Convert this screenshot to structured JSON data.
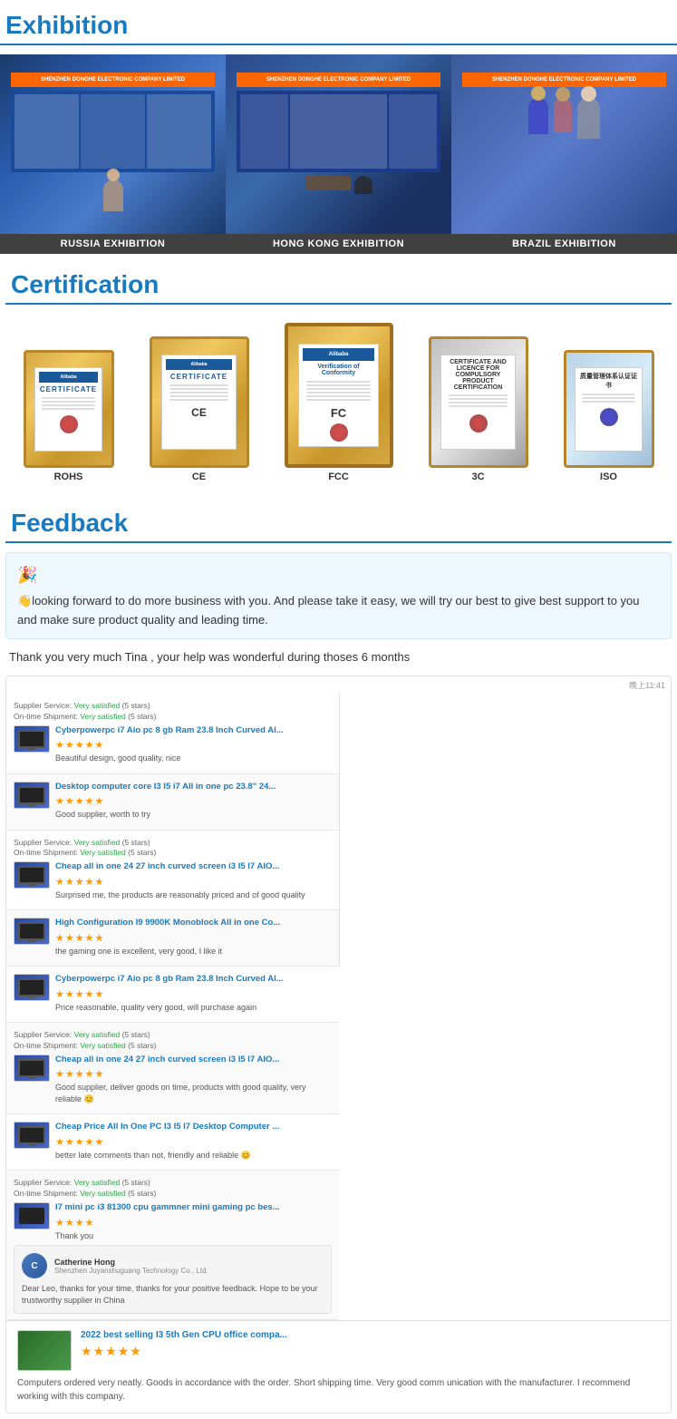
{
  "exhibition": {
    "title": "Exhibition",
    "items": [
      {
        "label": "RUSSIA EXHIBITION",
        "type": "russia"
      },
      {
        "label": "HONG KONG EXHIBITION",
        "type": "hongkong"
      },
      {
        "label": "BRAZIL EXHIBITION",
        "type": "brazil"
      }
    ],
    "company_name": "SHENZHEN DONGHE ELECTRONIC COMPANY LIMITED"
  },
  "certification": {
    "title": "Certification",
    "items": [
      {
        "label": "ROHS",
        "size": "small"
      },
      {
        "label": "CE",
        "size": "medium"
      },
      {
        "label": "FCC",
        "size": "large"
      },
      {
        "label": "3C",
        "size": "medium"
      },
      {
        "label": "ISO",
        "size": "small"
      }
    ]
  },
  "feedback": {
    "title": "Feedback",
    "icon": "👋",
    "message": "looking forward to do more business with you. And please take it easy, we will try our best to give best support to you and make sure product quality and leading time.",
    "thanks": "Thank you very much Tina , your help was wonderful during thoses  6 months",
    "review_time": "晚上11:41",
    "reviews_left": [
      {
        "supplier_service": "Very satisfied",
        "supplier_service_stars": "(5 stars)",
        "ontime_shipment": "Very satisfied",
        "ontime_shipment_stars": "(5 stars)",
        "product": "Cyberpowerpc i7 Aio pc 8 gb Ram 23.8 Inch Curved Al...",
        "stars": "★★★★★",
        "text": "Beautiful design, good quality, nice"
      },
      {
        "product": "Desktop computer core I3 I5 i7 All in one pc 23.8\" 24...",
        "stars": "★★★★★",
        "text": "Good supplier, worth to try"
      },
      {
        "supplier_service": "Very satisfied",
        "supplier_service_stars": "(5 stars)",
        "ontime_shipment": "Very satisfied",
        "ontime_shipment_stars": "(5 stars)",
        "product": "Cheap all in one 24 27 inch curved screen i3 I5 I7 AIO...",
        "stars": "★★★★★",
        "text": "Surprised me, the products are reasonably priced and of good quality"
      },
      {
        "product": "High Configuration I9 9900K Monoblock All in one Co...",
        "stars": "★★★★★",
        "text": "the gaming one is excellent, very good, I like it"
      }
    ],
    "reviews_right": [
      {
        "product": "Cyberpowerpc i7 Aio pc 8 gb Ram 23.8 Inch Curved Al...",
        "stars": "★★★★★",
        "text": "Price reasonable, quality very good, will purchase again"
      },
      {
        "supplier_service": "Very satisfied",
        "supplier_service_stars": "(5 stars)",
        "ontime_shipment": "Very satisfied",
        "ontime_shipment_stars": "(5 stars)",
        "product": "Cheap all in one 24 27 inch curved screen i3 I5 I7 AIO...",
        "stars": "★★★★★",
        "text": "Good supplier, deliver goods on time, products with good quality, very reliable 😊"
      },
      {
        "product": "Cheap Price All In One PC I3 I5 I7 Desktop Computer ...",
        "stars": "★★★★★",
        "text": "better late comments than not, friendly and reliable 😊"
      },
      {
        "supplier_service": "Very satisfied",
        "supplier_service_stars": "(5 stars)",
        "ontime_shipment": "Very satisfied",
        "ontime_shipment_stars": "(5 stars)",
        "product": "I7 mini pc i3 81300 cpu gammner mini gaming pc bes...",
        "stars": "★★★★",
        "text": "Thank you"
      }
    ],
    "full_review": {
      "product": "2022 best selling I3 5th Gen CPU office compa...",
      "stars": "★★★★★",
      "text": "Computers ordered very neatly. Goods in accordance with the order. Short shipping time. Very good comm unication with the manufacturer. I recommend working with this company."
    },
    "catherine": {
      "name": "Catherine Hong",
      "company": "Shenzhen Juyanshuguang Technology Co., Ltd.",
      "initial": "C",
      "message": "Dear Leo, thanks for your time, thanks for your positive feedback. Hope to be your trustworthy supplier in China"
    }
  }
}
